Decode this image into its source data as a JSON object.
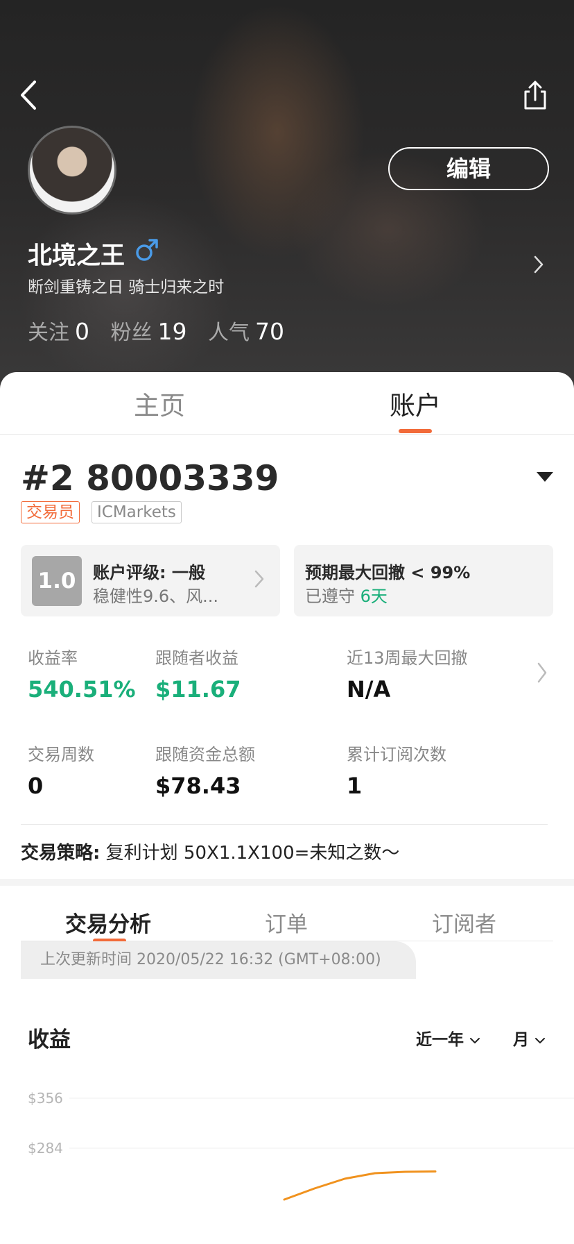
{
  "header": {
    "edit_label": "编辑",
    "username": "北境之王",
    "gender": "male",
    "bio": "断剑重铸之日 骑士归来之时",
    "stats": [
      {
        "label": "关注",
        "value": "0"
      },
      {
        "label": "粉丝",
        "value": "19"
      },
      {
        "label": "人气",
        "value": "70"
      }
    ]
  },
  "tabs": {
    "home": "主页",
    "account": "账户",
    "active": "account"
  },
  "account": {
    "title": "#2 80003339",
    "tag_role": "交易员",
    "tag_broker": "ICMarkets"
  },
  "rating_card": {
    "score": "1.0",
    "title": "账户评级: 一般",
    "subtitle": "稳健性9.6、风..."
  },
  "drawdown_card": {
    "title": "预期最大回撤 < 99%",
    "subtitle_prefix": "已遵守",
    "subtitle_value": "6天"
  },
  "metrics": [
    {
      "label": "收益率",
      "value": "540.51%"
    },
    {
      "label": "跟随者收益",
      "value": "$11.67"
    },
    {
      "label": "近13周最大回撤",
      "value": "N/A"
    },
    {
      "label": "交易周数",
      "value": "0"
    },
    {
      "label": "跟随资金总额",
      "value": "$78.43"
    },
    {
      "label": "累计订阅次数",
      "value": "1"
    }
  ],
  "strategy": {
    "label": "交易策略:",
    "text": "复利计划 50X1.1X100=未知之数～"
  },
  "sub_tabs": {
    "analysis": "交易分析",
    "orders": "订单",
    "subscribers": "订阅者",
    "active": "analysis"
  },
  "update_text": "上次更新时间 2020/05/22 16:32 (GMT+08:00)",
  "chart_section": {
    "title": "收益",
    "period": "近一年",
    "unit": "月"
  },
  "chart_data": {
    "type": "line",
    "title": "收益",
    "y_tick_labels": [
      "$356",
      "$284"
    ],
    "ylim": [
      212,
      356
    ],
    "y_ticks": [
      356,
      284
    ],
    "series": [
      {
        "values": [
          210,
          226,
          240,
          248,
          250,
          250.5
        ]
      }
    ],
    "line_color": "#f0921e",
    "grid": true
  },
  "colors": {
    "accent": "#f26b3a",
    "positive": "#1aaf7a",
    "gender": "#4a9be8"
  }
}
